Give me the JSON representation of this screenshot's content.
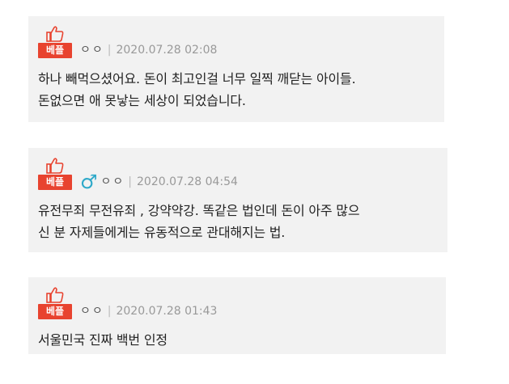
{
  "comments": [
    {
      "badge": "베플",
      "author": "ㅇㅇ",
      "separator": "|",
      "date": "2020.07.28 02:08",
      "lines": [
        "하나 빼먹으셨어요. 돈이 최고인걸 너무 일찍 깨닫는 아이들.",
        "돈없으면 애 못낳는 세상이 되었습니다."
      ]
    },
    {
      "badge": "베플",
      "gender_symbol": "♂",
      "author": "ㅇㅇ",
      "separator": "|",
      "date": "2020.07.28 04:54",
      "lines": [
        "유전무죄 무전유죄 , 강약약강. 똑같은 법인데 돈이 아주 많으",
        "신 분 자제들에게는 유동적으로 관대해지는 법."
      ]
    },
    {
      "badge": "베플",
      "author": "ㅇㅇ",
      "separator": "|",
      "date": "2020.07.28 01:43",
      "lines": [
        "서울민국 진짜 백번 인정"
      ]
    }
  ],
  "colors": {
    "badge_red": "#e8432f",
    "male_blue": "#2ea9c9",
    "card_bg": "#f2f2f2"
  },
  "icons": {
    "thumb": "thumbs-up-icon",
    "male": "male-icon"
  }
}
